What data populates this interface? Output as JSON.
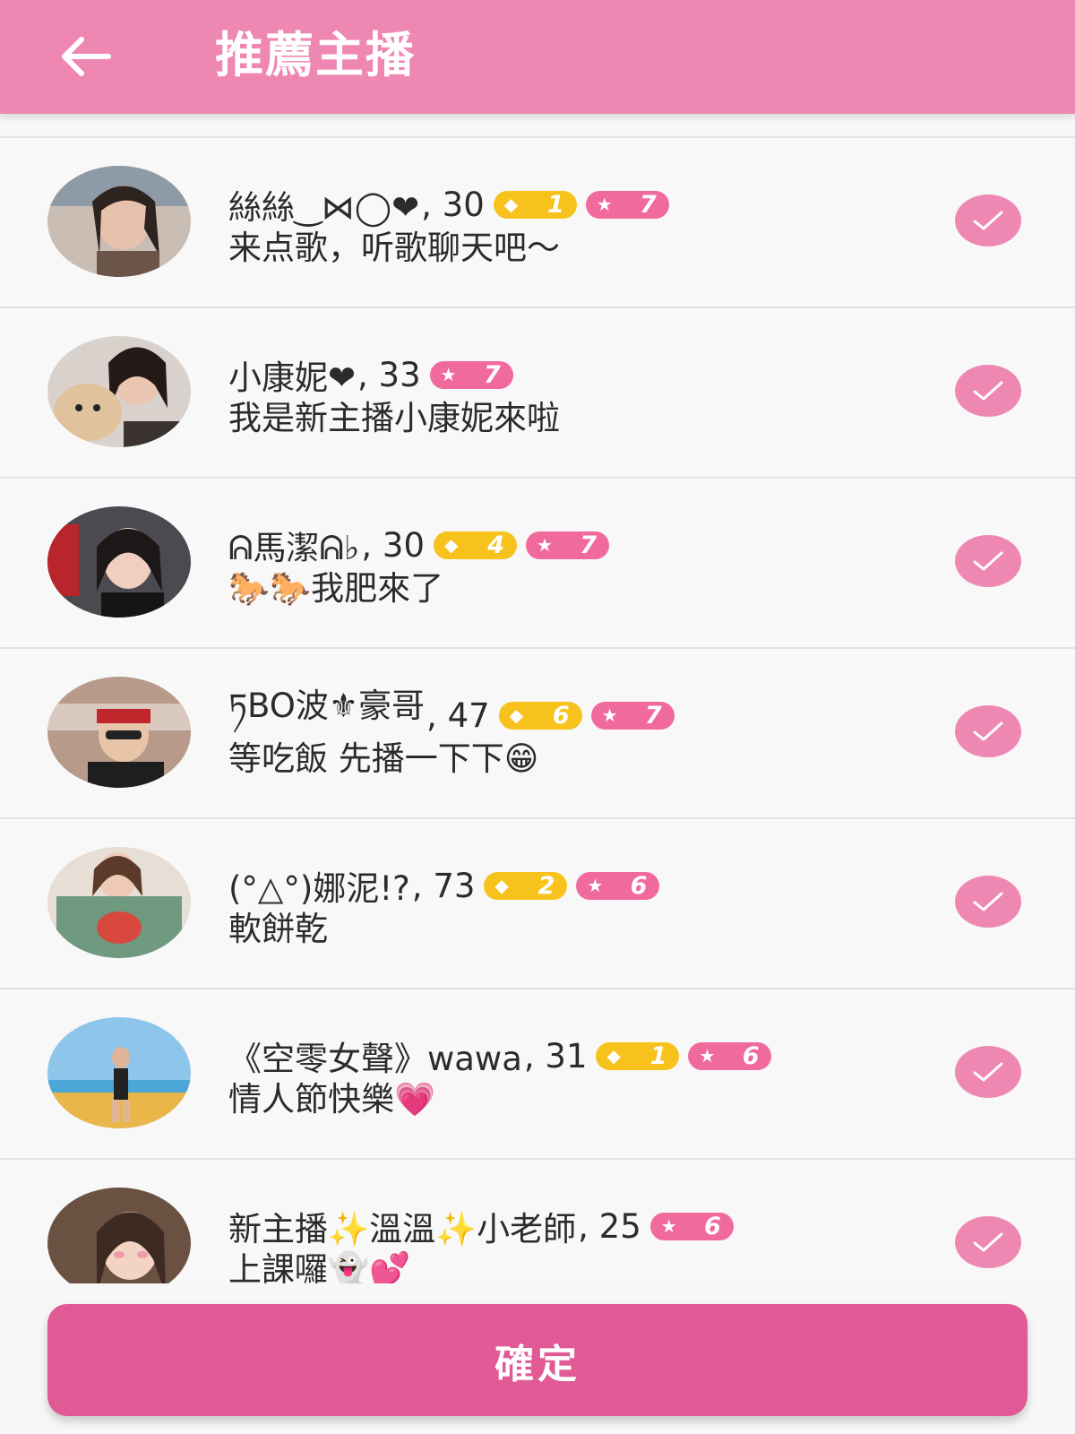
{
  "header": {
    "title": "推薦主播",
    "back_icon": "arrow-left-icon"
  },
  "colors": {
    "header_bg": "#ee88b3",
    "confirm_bg": "#e15a95",
    "gold_badge": "#f7c21c",
    "pink_badge": "#f06a9d"
  },
  "streamers": [
    {
      "nick": "絲絲‿⋈◯❤",
      "age": ", 30",
      "gold_level": "1",
      "star_level": "7",
      "bio": "来点歌，听歌聊天吧～",
      "checked": true
    },
    {
      "nick": "小康妮❤",
      "age": ", 33",
      "gold_level": "",
      "star_level": "7",
      "bio": "我是新主播小康妮來啦",
      "checked": true
    },
    {
      "nick": "ᕱ馬潔ᕱ♭",
      "age": ", 30",
      "gold_level": "4",
      "star_level": "7",
      "bio": "🐎🐎我肥來了",
      "checked": true
    },
    {
      "nick": "ཏBO波⚜豪哥",
      "age": ", 47",
      "gold_level": "6",
      "star_level": "7",
      "bio": "等吃飯 先播一下下😁",
      "checked": true
    },
    {
      "nick": "(°△°)娜泥!?",
      "age": ", 73",
      "gold_level": "2",
      "star_level": "6",
      "bio": "軟餅乾",
      "checked": true
    },
    {
      "nick": "《空零女聲》wawa",
      "age": ", 31",
      "gold_level": "1",
      "star_level": "6",
      "bio": "情人節快樂💗",
      "checked": true
    },
    {
      "nick": "新主播✨溫溫✨小老師",
      "age": ", 25",
      "gold_level": "",
      "star_level": "6",
      "bio": "上課囉👻💕",
      "checked": true
    }
  ],
  "confirm_label": "確定"
}
